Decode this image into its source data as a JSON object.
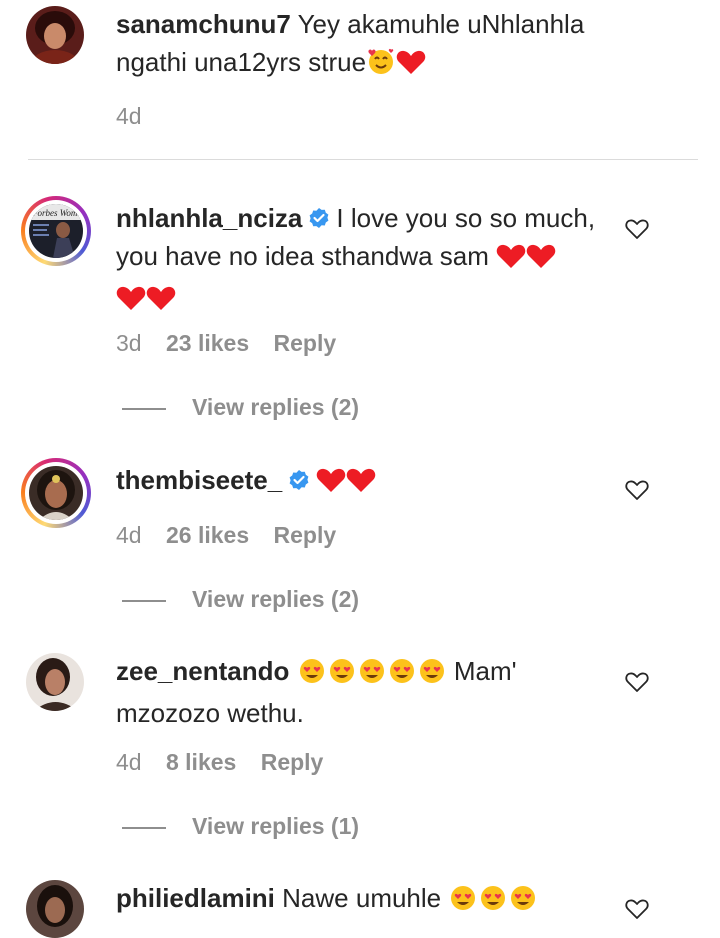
{
  "comments": [
    {
      "username": "sanamchunu7",
      "verified": false,
      "text_line1": "Yey akamuhle uNhlanhla",
      "text_line2": "ngathi una12yrs strue",
      "time": "4d"
    },
    {
      "username": "nhlanhla_nciza",
      "verified": true,
      "text_line1": "I love you so so much,",
      "text_line2": "you have no idea sthandwa sam",
      "time": "3d",
      "likes": "23 likes",
      "reply_label": "Reply",
      "view_replies": "View replies (2)",
      "avatar_caption": "Forbes Woman"
    },
    {
      "username": "thembiseete_",
      "verified": true,
      "time": "4d",
      "likes": "26 likes",
      "reply_label": "Reply",
      "view_replies": "View replies (2)"
    },
    {
      "username": "zee_nentando",
      "verified": false,
      "text_line1": "Mam'",
      "text_line2": "mzozozo wethu.",
      "time": "4d",
      "likes": "8 likes",
      "reply_label": "Reply",
      "view_replies": "View replies (1)"
    },
    {
      "username": "philiedlamini",
      "verified": false,
      "text_line1": "Nawe umuhle"
    }
  ],
  "colors": {
    "text": "#262626",
    "muted": "#8e8e8e",
    "verified_blue": "#3897f0",
    "heart_red": "#ed1c24"
  }
}
